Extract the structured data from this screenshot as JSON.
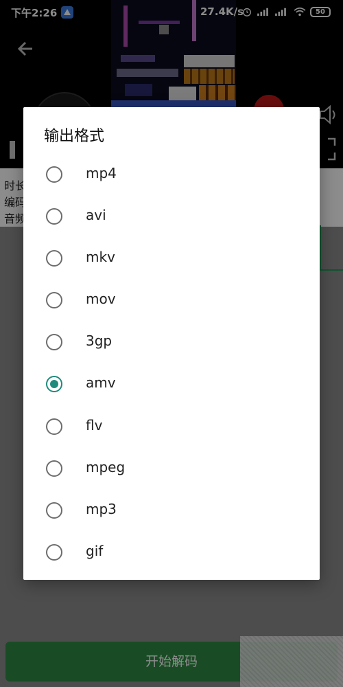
{
  "statusbar": {
    "time": "下午2:26",
    "network_speed": "27.4K/s",
    "battery": "50"
  },
  "icons": {
    "back": "arrow-left-icon",
    "alarm": "alarm-icon",
    "signal": "signal-icon",
    "wifi": "wifi-icon",
    "volume": "volume-icon"
  },
  "info": {
    "line1": "时长",
    "line2": "编码",
    "line3": "音频"
  },
  "dialog": {
    "title": "输出格式",
    "options": [
      "mp4",
      "avi",
      "mkv",
      "mov",
      "3gp",
      "amv",
      "flv",
      "mpeg",
      "mp3",
      "gif"
    ],
    "selected": "amv"
  },
  "start_button": {
    "label": "开始解码"
  },
  "colors": {
    "accent": "#1f8a7c",
    "button_green": "#2e8a43"
  }
}
